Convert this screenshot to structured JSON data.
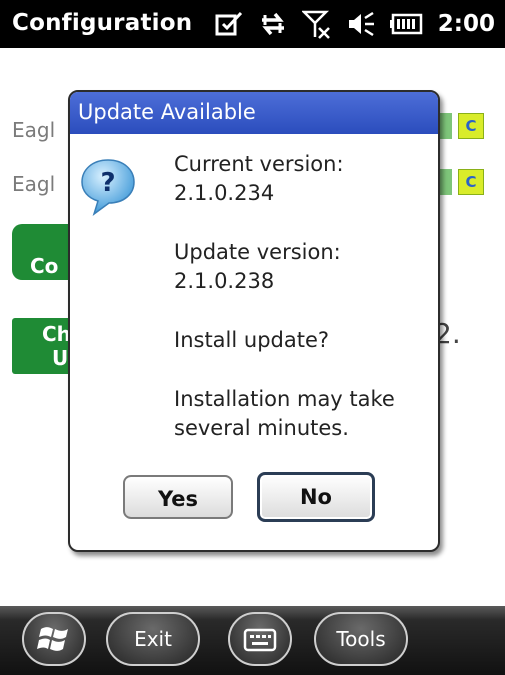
{
  "status_bar": {
    "title": "Configuration",
    "time": "2:00",
    "icons": [
      "edit-checkbox-icon",
      "data-sync-arrows-icon",
      "no-signal-icon",
      "volume-mute-icon",
      "battery-icon"
    ]
  },
  "background": {
    "row1_label": "Eagl",
    "row2_label": "Eagl",
    "green_button_label": "Co",
    "green_small_line1": "Ch",
    "green_small_line2": "U",
    "c_icon_text": "C",
    "right_char": "2."
  },
  "dialog": {
    "title": "Update Available",
    "current_label": "Current version:",
    "current_value": "2.1.0.234",
    "update_label": "Update version:",
    "update_value": "2.1.0.238",
    "question": "Install update?",
    "note_line1": "Installation may take",
    "note_line2": "several minutes.",
    "yes_label": "Yes",
    "no_label": "No"
  },
  "taskbar": {
    "exit_label": "Exit",
    "tools_label": "Tools",
    "icons": [
      "windows-start-icon",
      "keyboard-icon"
    ]
  },
  "colors": {
    "titlebar_blue": "#3356c9",
    "green": "#1f8b35",
    "status_black": "#000000"
  }
}
